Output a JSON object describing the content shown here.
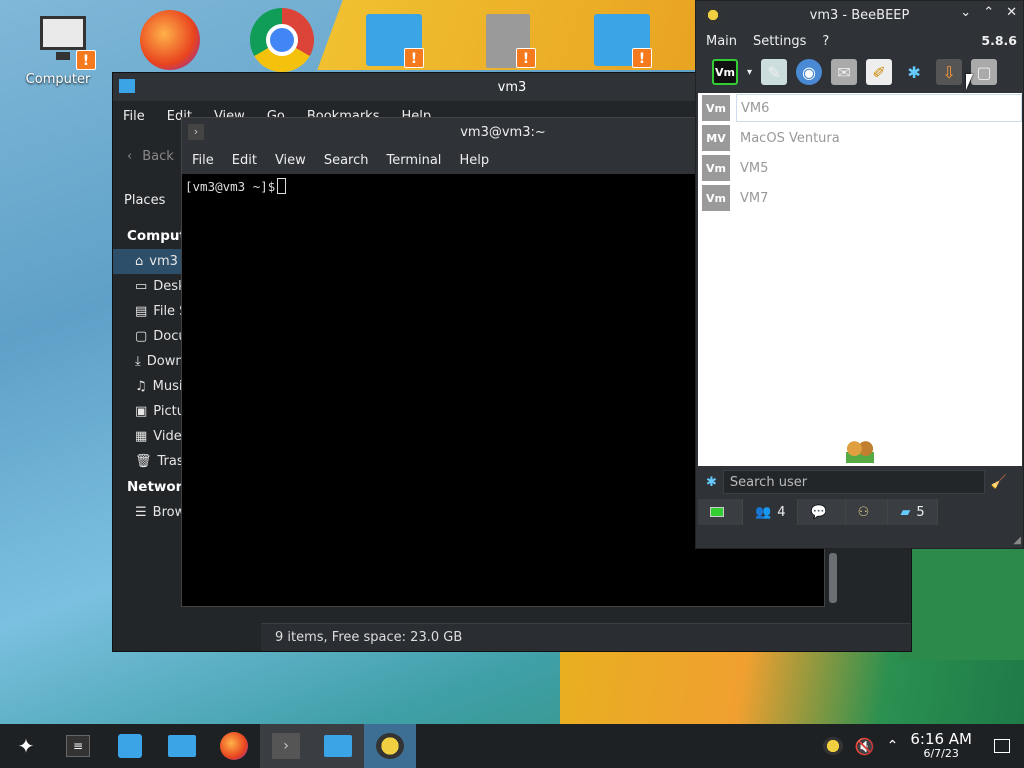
{
  "desktop": {
    "computer_label": "Computer"
  },
  "dolphin": {
    "title": "vm3",
    "menu": [
      "File",
      "Edit",
      "View",
      "Go",
      "Bookmarks",
      "Help"
    ],
    "back_label": "Back",
    "places_label": "Places",
    "sections": [
      {
        "title": "Computer",
        "items": [
          "vm3",
          "Desktop",
          "File System",
          "Documents",
          "Downloads",
          "Music",
          "Pictures",
          "Videos",
          "Trash"
        ]
      },
      {
        "title": "Network",
        "items": [
          "Browse"
        ]
      }
    ],
    "status": "9 items, Free space: 23.0 GB"
  },
  "terminal": {
    "title": "vm3@vm3:~",
    "menu": [
      "File",
      "Edit",
      "View",
      "Search",
      "Terminal",
      "Help"
    ],
    "prompt": "[vm3@vm3 ~]$"
  },
  "beebeep": {
    "title": "vm3 - BeeBEEP",
    "menu": [
      "Main",
      "Settings",
      "?"
    ],
    "version": "5.8.6",
    "status_badge": "Vm",
    "users": [
      {
        "badge": "Vm",
        "name": "VM6",
        "selected": true
      },
      {
        "badge": "MV",
        "name": "MacOS Ventura",
        "selected": false
      },
      {
        "badge": "Vm",
        "name": "VM5",
        "selected": false
      },
      {
        "badge": "Vm",
        "name": "VM7",
        "selected": false
      }
    ],
    "search_placeholder": "Search user",
    "tabs": [
      {
        "icon": "chat-icon",
        "count": ""
      },
      {
        "icon": "users-icon",
        "count": "4"
      },
      {
        "icon": "message-icon",
        "count": ""
      },
      {
        "icon": "group-icon",
        "count": ""
      },
      {
        "icon": "file-icon",
        "count": "5"
      }
    ]
  },
  "taskbar": {
    "time": "6:16 AM",
    "date": "6/7/23"
  }
}
